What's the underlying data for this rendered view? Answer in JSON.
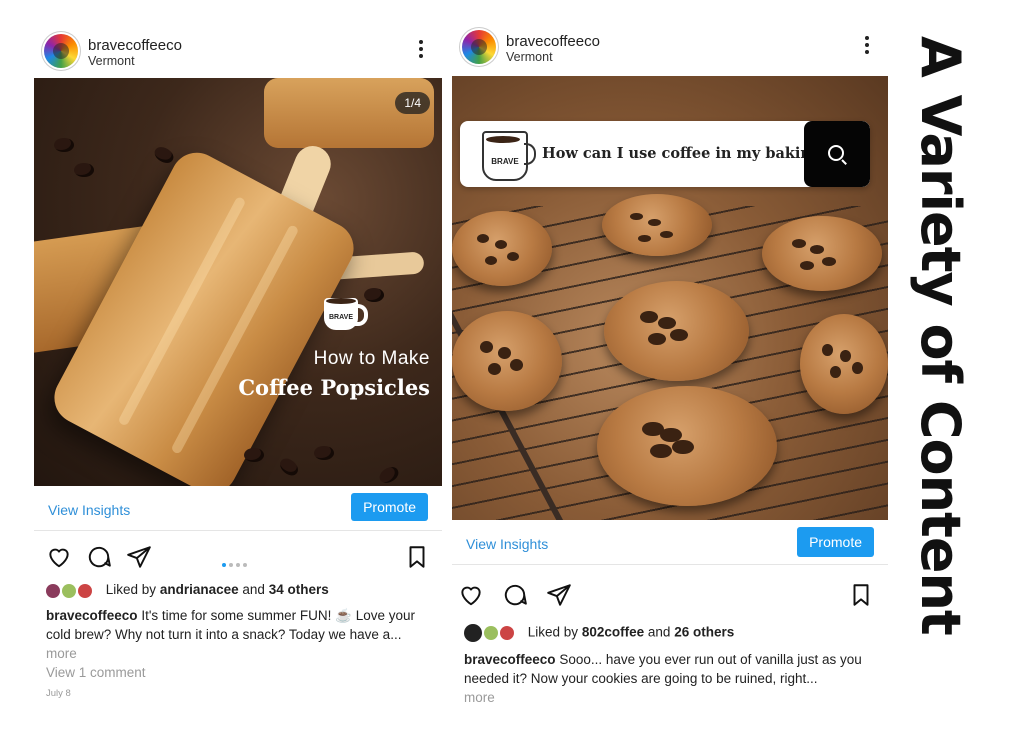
{
  "side_title": "A Variety of Content",
  "post1": {
    "username": "bravecoffeeco",
    "location": "Vermont",
    "image_counter": "1/4",
    "overlay_brand": "BRAVE",
    "overlay_line1": "How to Make",
    "overlay_line2": "Coffee Popsicles",
    "insights_label": "View Insights",
    "promote_label": "Promote",
    "liked_prefix": "Liked by",
    "liked_user": "andrianacee",
    "liked_and": "and",
    "liked_others": "34 others",
    "caption_user": "bravecoffeeco",
    "caption_text": "It's time for some summer FUN! ☕ Love your cold brew? Why not turn it into a snack? Today we have a...",
    "more_label": "more",
    "comments_label": "View 1 comment",
    "date": "July 8"
  },
  "post2": {
    "username": "bravecoffeeco",
    "location": "Vermont",
    "overlay_brand": "BRAVE",
    "search_text": "How can I use coffee in my baking?",
    "insights_label": "View Insights",
    "promote_label": "Promote",
    "liked_prefix": "Liked by",
    "liked_user": "802coffee",
    "liked_and": "and",
    "liked_others": "26 others",
    "caption_user": "bravecoffeeco",
    "caption_text": "Sooo... have you ever run out of vanilla just as you needed it? Now your cookies are going to be ruined, right...",
    "more_label": "more"
  },
  "colors": {
    "link_blue": "#2f8fd8",
    "promote_blue": "#1c9bf0",
    "muted_gray": "#9a9a9a"
  },
  "icons": [
    "heart-icon",
    "comment-icon",
    "share-icon",
    "bookmark-icon",
    "kebab-menu-icon",
    "search-icon"
  ]
}
